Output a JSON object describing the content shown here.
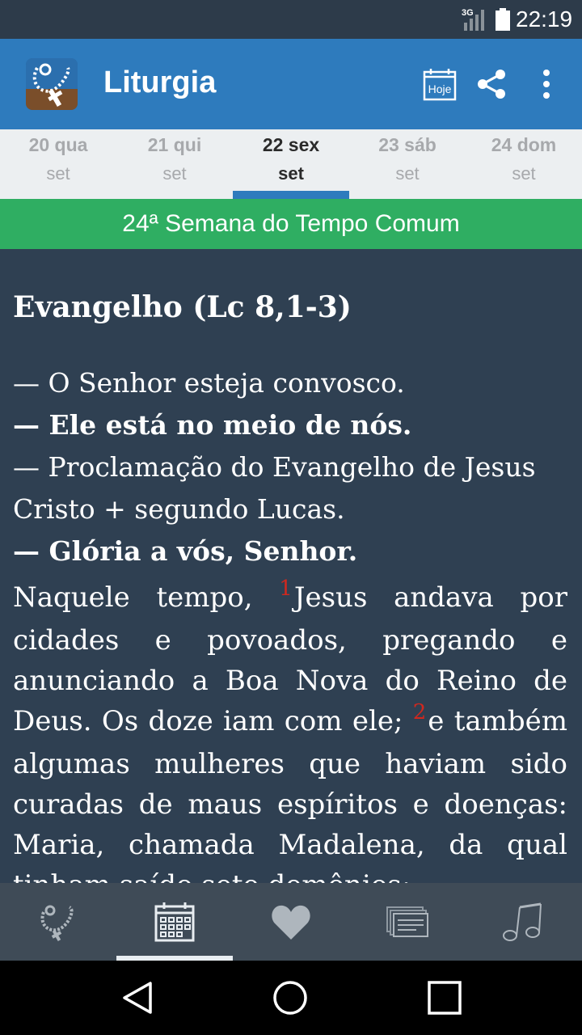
{
  "status_bar": {
    "network": "3G",
    "time": "22:19"
  },
  "app_bar": {
    "title": "Liturgia",
    "today_label": "Hoje"
  },
  "tabs": [
    {
      "day": "20 qua",
      "month": "set"
    },
    {
      "day": "21 qui",
      "month": "set"
    },
    {
      "day": "22 sex",
      "month": "set",
      "selected": true
    },
    {
      "day": "23 sáb",
      "month": "set"
    },
    {
      "day": "24 dom",
      "month": "set"
    }
  ],
  "week_label": "24ª Semana do Tempo Comum",
  "reading": {
    "title": "Evangelho (Lc 8,1-3)",
    "lines": [
      {
        "text": "— O Senhor esteja convosco."
      },
      {
        "text": "— Ele está no meio de nós."
      },
      {
        "text": "— Proclamação do Evangelho de Jesus Cristo + segundo Lucas."
      },
      {
        "text": "— Glória a vós, Senhor."
      }
    ],
    "verse1_num": "1",
    "verse1_text": "Jesus andava por cidades e povoados, pregando e anunciando a Boa Nova do Reino de Deus. Os doze iam com ele; ",
    "verse2_num": "2",
    "verse2_text": "e também algumas mulheres que haviam sido curadas de maus espíritos e doenças: Maria, chamada Madalena, da qual tinham saído sete demônios;"
  },
  "bottom_nav": [
    {
      "icon": "rosary-icon"
    },
    {
      "icon": "calendar-icon",
      "selected": true
    },
    {
      "icon": "heart-icon"
    },
    {
      "icon": "news-icon"
    },
    {
      "icon": "music-note-icon"
    }
  ],
  "colors": {
    "status_bar": "#2d3b4a",
    "app_bar": "#2e7bbd",
    "week_bar": "#2fae62",
    "content_bg": "#2f4052",
    "bottom_nav": "#3f4b57",
    "verse_number": "#d0281f"
  }
}
